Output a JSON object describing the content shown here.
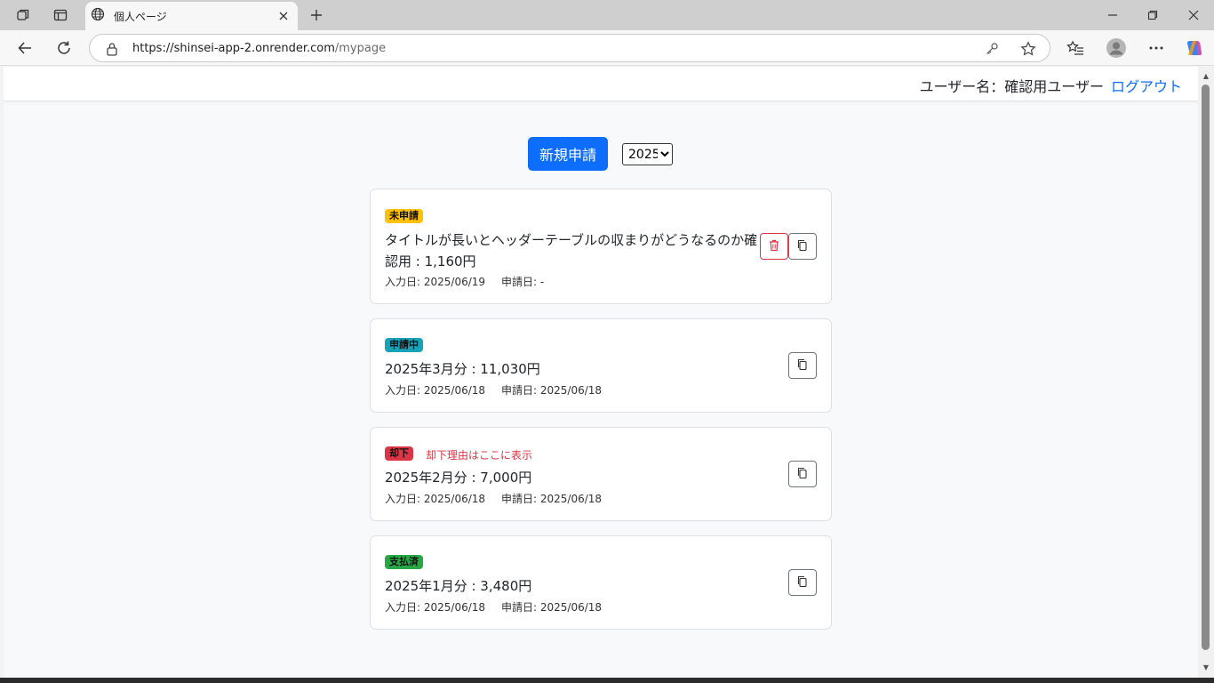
{
  "browser": {
    "tab_title": "個人ページ",
    "url_host": "https://shinsei-app-2.onrender.com",
    "url_path": "/mypage"
  },
  "header": {
    "user_label": "ユーザー名：確認用ユーザー",
    "logout_label": "ログアウト"
  },
  "toolbar": {
    "new_button_label": "新規申請",
    "year_options": [
      "2025"
    ],
    "year_selected": "2025"
  },
  "colors": {
    "primary": "#0d6efd",
    "status_draft": "#ffc107",
    "status_pending": "#17a2b8",
    "status_rejected": "#dc3545",
    "status_paid": "#28a745"
  },
  "applications": [
    {
      "status": "未申請",
      "status_color": "#ffc107",
      "title": "タイトルが長いとヘッダーテーブルの収まりがどうなるのか確認用 : 1,160円",
      "input_date": "入力日: 2025/06/19",
      "apply_date": "申請日: -",
      "has_delete": true,
      "copy_icon": "copy-icon",
      "delete_icon": "trash-icon"
    },
    {
      "status": "申請中",
      "status_color": "#17a2b8",
      "title": "2025年3月分 : 11,030円",
      "input_date": "入力日: 2025/06/18",
      "apply_date": "申請日: 2025/06/18",
      "has_delete": false,
      "copy_icon": "copy-icon"
    },
    {
      "status": "却下",
      "status_color": "#dc3545",
      "reject_reason": "却下理由はここに表示",
      "title": "2025年2月分 : 7,000円",
      "input_date": "入力日: 2025/06/18",
      "apply_date": "申請日: 2025/06/18",
      "has_delete": false,
      "copy_icon": "copy-icon"
    },
    {
      "status": "支払済",
      "status_color": "#28a745",
      "title": "2025年1月分 : 3,480円",
      "input_date": "入力日: 2025/06/18",
      "apply_date": "申請日: 2025/06/18",
      "has_delete": false,
      "copy_icon": "copy-icon"
    }
  ]
}
